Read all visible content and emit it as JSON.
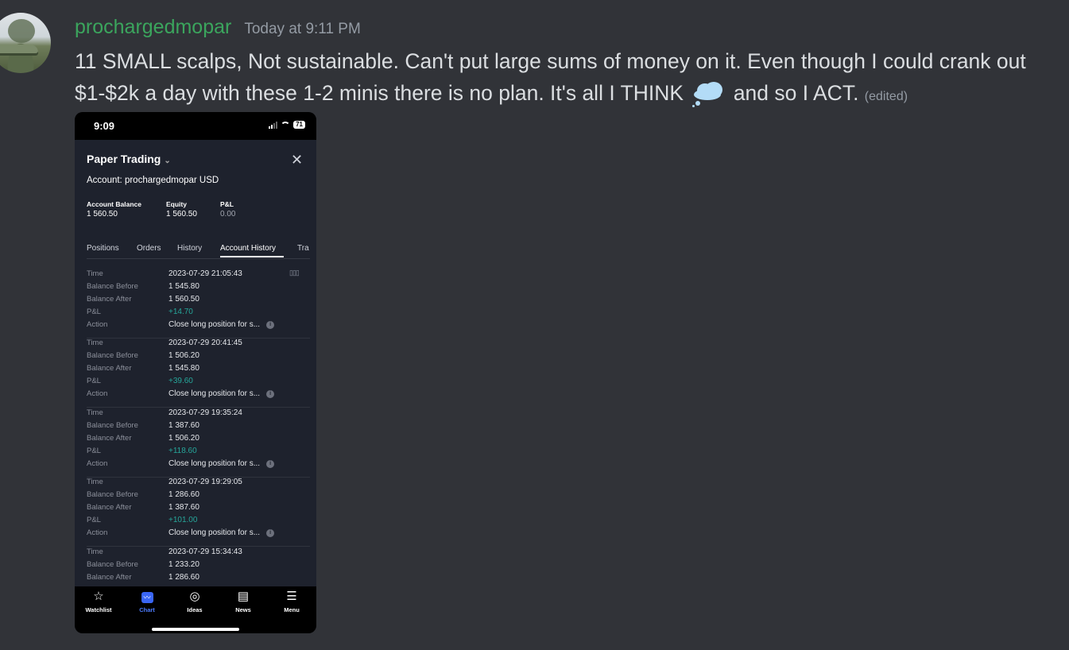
{
  "message": {
    "username": "prochargedmopar",
    "timestamp": "Today at 9:11 PM",
    "text_before_emoji": "11 SMALL scalps, Not sustainable.  Can't put large sums of money on it.   Even though I could crank out $1-$2k a day with these 1-2 minis there is no plan.  It's all I THINK",
    "emoji": "thought-balloon",
    "text_after_emoji": " and so I ACT. ",
    "edited_label": "(edited)"
  },
  "phone": {
    "status": {
      "time": "9:09",
      "battery": "71"
    },
    "title": "Paper Trading",
    "account": "Account: prochargedmopar USD",
    "stats": [
      {
        "label": "Account Balance",
        "value": "1 560.50"
      },
      {
        "label": "Equity",
        "value": "1 560.50"
      },
      {
        "label": "P&L",
        "value": "0.00"
      }
    ],
    "tabs": [
      "Positions",
      "Orders",
      "History",
      "Account History",
      "Tra"
    ],
    "field_labels": {
      "time": "Time",
      "before": "Balance Before",
      "after": "Balance After",
      "pnl": "P&L",
      "action": "Action"
    },
    "records": [
      {
        "time": "2023-07-29 21:05:43",
        "before": "1 545.80",
        "after": "1 560.50",
        "pnl": "+14.70",
        "action": "Close long position for s..."
      },
      {
        "time": "2023-07-29 20:41:45",
        "before": "1 506.20",
        "after": "1 545.80",
        "pnl": "+39.60",
        "action": "Close long position for s..."
      },
      {
        "time": "2023-07-29 19:35:24",
        "before": "1 387.60",
        "after": "1 506.20",
        "pnl": "+118.60",
        "action": "Close long position for s..."
      },
      {
        "time": "2023-07-29 19:29:05",
        "before": "1 286.60",
        "after": "1 387.60",
        "pnl": "+101.00",
        "action": "Close long position for s..."
      },
      {
        "time": "2023-07-29 15:34:43",
        "before": "1 233.20",
        "after": "1 286.60"
      }
    ],
    "nav": [
      {
        "label": "Watchlist",
        "icon": "star-icon"
      },
      {
        "label": "Chart",
        "icon": "chart-icon"
      },
      {
        "label": "Ideas",
        "icon": "lightbulb-icon"
      },
      {
        "label": "News",
        "icon": "news-icon"
      },
      {
        "label": "Menu",
        "icon": "menu-icon"
      }
    ],
    "accent_color": "#4d7cff",
    "positive_color": "#26a69a"
  }
}
